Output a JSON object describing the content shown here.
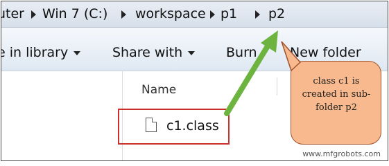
{
  "address_bar": {
    "crumbs": [
      "uter",
      "Win 7 (C:)",
      "workspace",
      "p1",
      "p2"
    ]
  },
  "toolbar": {
    "library_label": "e in library",
    "share_label": "Share with",
    "burn_label": "Burn",
    "new_folder_label": "New folder"
  },
  "file_list": {
    "column_header": "Name",
    "files": [
      {
        "name": "c1.class",
        "icon": "file-icon"
      }
    ]
  },
  "annotation": {
    "text": "class c1 is created in sub-folder p2",
    "fill_color": "#f7b98d",
    "arrow_color": "#6cb33f",
    "highlight_color": "#c9302c"
  },
  "watermark": "www.mfgrobots.com"
}
